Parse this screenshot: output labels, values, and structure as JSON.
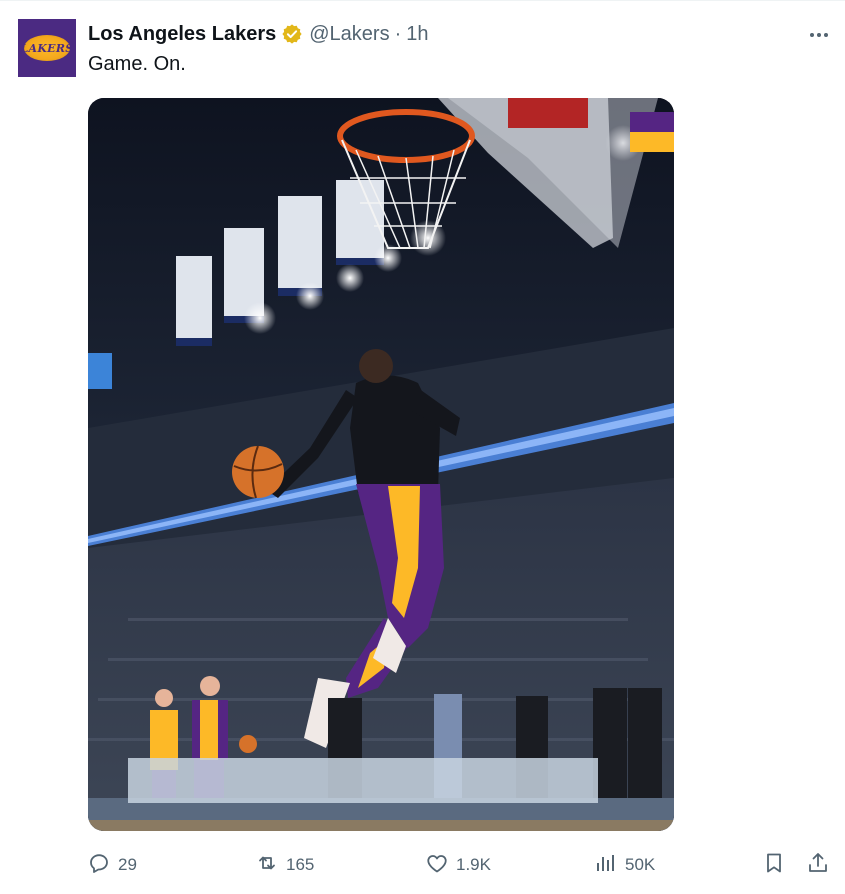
{
  "tweet": {
    "display_name": "Los Angeles Lakers",
    "handle": "@Lakers",
    "separator": "·",
    "time": "1h",
    "text": "Game. On.",
    "avatar_logo": "LAKERS"
  },
  "actions": {
    "replies": "29",
    "retweets": "165",
    "likes": "1.9K",
    "views": "50K"
  },
  "icons": {
    "verified": "verified-badge-icon",
    "more": "more-dots-icon",
    "reply": "reply-icon",
    "retweet": "retweet-icon",
    "like": "heart-icon",
    "views": "views-chart-icon",
    "bookmark": "bookmark-icon",
    "share": "share-icon"
  },
  "colors": {
    "text_primary": "#0f1419",
    "text_secondary": "#536471",
    "lakers_purple": "#552583",
    "lakers_gold": "#fdb927",
    "verified_gold": "#e2b719"
  }
}
